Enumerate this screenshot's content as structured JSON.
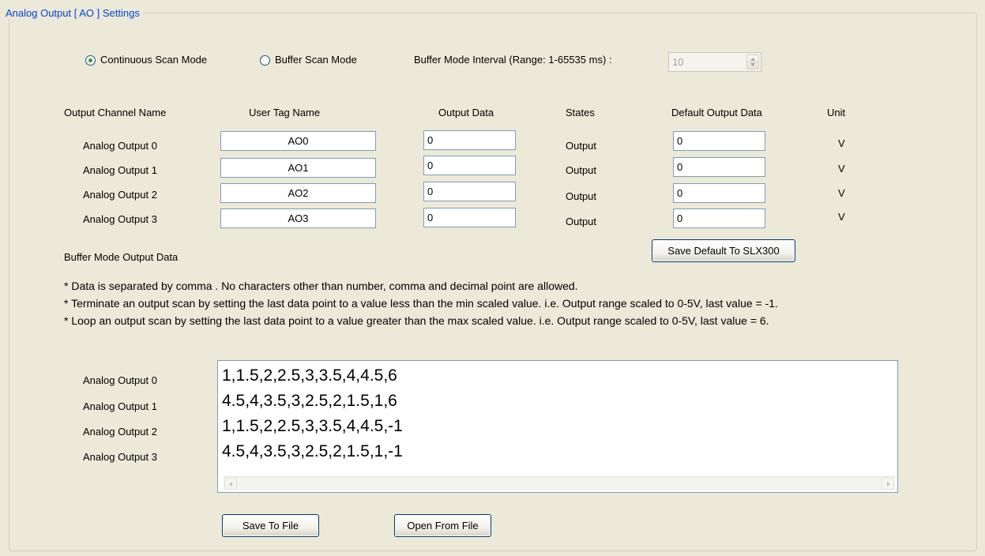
{
  "group_title": "Analog Output [ AO ] Settings",
  "modes": {
    "continuous_label": "Continuous Scan Mode",
    "buffer_label": "Buffer Scan Mode",
    "selected": "continuous",
    "interval_label": "Buffer Mode Interval (Range: 1-65535 ms)  :",
    "interval_value": "10"
  },
  "headers": {
    "channel": "Output Channel Name",
    "tag": "User Tag Name",
    "output": "Output Data",
    "states": "States",
    "default": "Default Output Data",
    "unit": "Unit"
  },
  "channels": [
    {
      "name": "Analog Output 0",
      "tag": "AO0",
      "output": "0",
      "state": "Output",
      "default": "0",
      "unit": "V"
    },
    {
      "name": "Analog Output 1",
      "tag": "AO1",
      "output": "0",
      "state": "Output",
      "default": "0",
      "unit": "V"
    },
    {
      "name": "Analog Output 2",
      "tag": "AO2",
      "output": "0",
      "state": "Output",
      "default": "0",
      "unit": "V"
    },
    {
      "name": "Analog Output 3",
      "tag": "AO3",
      "output": "0",
      "state": "Output",
      "default": "0",
      "unit": "V"
    }
  ],
  "save_default_label": "Save Default To SLX300",
  "buffer_title": "Buffer Mode Output Data",
  "notes": [
    "* Data is separated by comma .  No characters other than number, comma and decimal point are allowed.",
    "* Terminate an output scan by setting the last data point to a value less than the min scaled value. i.e. Output range scaled to 0-5V, last value = -1.",
    "* Loop an output scan by setting the last data point to a value greater than the max scaled value. i.e. Output range scaled to 0-5V, last value = 6."
  ],
  "buffer_rows": [
    {
      "name": "Analog Output 0",
      "data": "1,1.5,2,2.5,3,3.5,4,4.5,6"
    },
    {
      "name": "Analog Output 1",
      "data": "4.5,4,3.5,3,2.5,2,1.5,1,6"
    },
    {
      "name": "Analog Output 2",
      "data": "1,1.5,2,2.5,3,3.5,4,4.5,-1"
    },
    {
      "name": "Analog Output 3",
      "data": "4.5,4,3.5,3,2.5,2,1.5,1,-1"
    }
  ],
  "buttons": {
    "save_file": "Save To File",
    "open_file": "Open From File"
  }
}
